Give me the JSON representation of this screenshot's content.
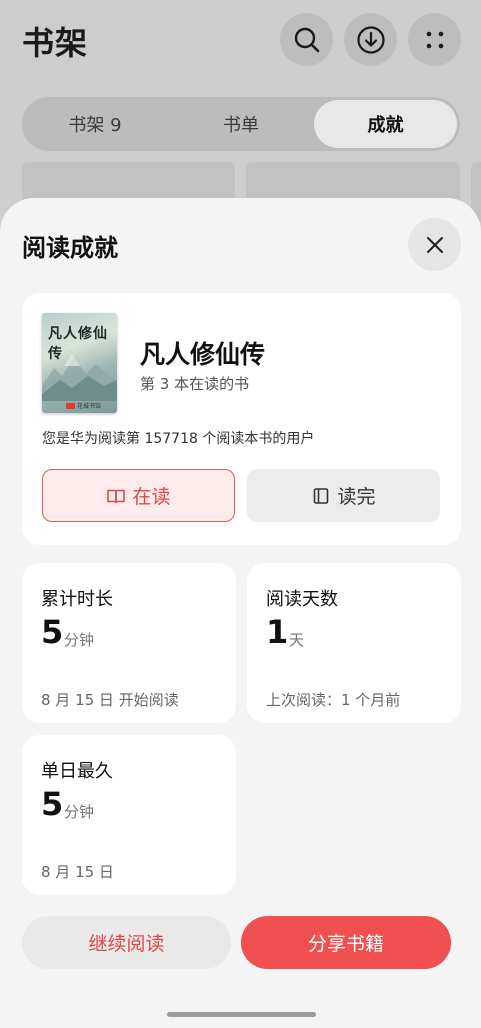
{
  "shelf": {
    "title": "书架",
    "tabs": [
      {
        "label": "书架 9",
        "active": false
      },
      {
        "label": "书单",
        "active": false
      },
      {
        "label": "成就",
        "active": true
      }
    ],
    "icons": [
      "search-icon",
      "download-icon",
      "more-icon"
    ]
  },
  "sheet": {
    "title": "阅读成就",
    "close_icon": "close-icon",
    "book": {
      "cover_title": "凡人修仙传",
      "cover_publisher": "花城书馆",
      "name": "凡人修仙传",
      "subtitle": "第 3 本在读的书",
      "users_text": "您是华为阅读第 157718 个阅读本书的用户",
      "reading_label": "在读",
      "finished_label": "读完",
      "status": "reading"
    },
    "stats": [
      {
        "label": "累计时长",
        "value": "5",
        "unit": "分钟",
        "note": "8 月 15 日 开始阅读"
      },
      {
        "label": "阅读天数",
        "value": "1",
        "unit": "天",
        "note": "上次阅读：1 个月前"
      },
      {
        "label": "单日最久",
        "value": "5",
        "unit": "分钟",
        "note": "8 月 15 日"
      }
    ],
    "continue_label": "继续阅读",
    "share_label": "分享书籍"
  },
  "colors": {
    "accent": "#f05050",
    "accent_text": "#e04848",
    "reading_bg": "#fdeceb",
    "sheet_bg": "#f4f4f4",
    "overlay_bg": "#cdcdcd"
  }
}
